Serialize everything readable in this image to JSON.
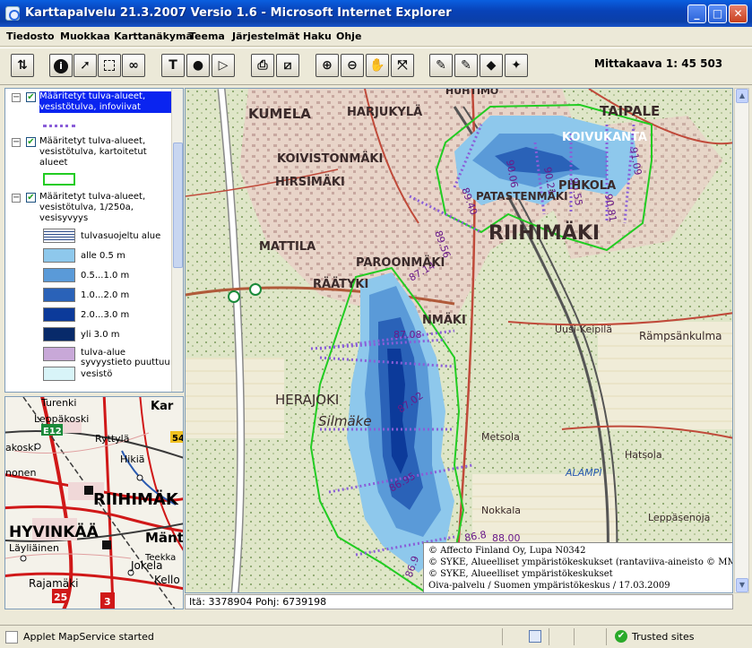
{
  "window": {
    "title": "Karttapalvelu 21.3.2007 Versio 1.6 - Microsoft Internet Explorer",
    "minimize": "_",
    "maximize": "□",
    "close": "✕"
  },
  "menu": [
    "Tiedosto",
    "Muokkaa",
    "Karttanäkymä",
    "Teema",
    "Järjestelmät",
    "Haku",
    "Ohje"
  ],
  "toolbar": {
    "buttons": [
      {
        "name": "refresh-icon"
      },
      {
        "name": "info-icon",
        "glyph": "i"
      },
      {
        "name": "pointer-icon"
      },
      {
        "name": "select-box-icon"
      },
      {
        "name": "binoculars-icon"
      },
      {
        "name": "text-tool-icon",
        "glyph": "T"
      },
      {
        "name": "point-tool-icon"
      },
      {
        "name": "polygon-tool-icon"
      },
      {
        "name": "print-icon"
      },
      {
        "name": "export-icon"
      },
      {
        "name": "zoom-in-icon"
      },
      {
        "name": "zoom-out-icon"
      },
      {
        "name": "pan-hand-icon"
      },
      {
        "name": "full-extent-icon"
      },
      {
        "name": "edit-layer-1-icon"
      },
      {
        "name": "edit-layer-2-icon"
      },
      {
        "name": "back-icon"
      },
      {
        "name": "forward-icon"
      }
    ],
    "scale_label": "Mittakaava 1: 45 503"
  },
  "legend": {
    "groups": [
      {
        "title": [
          "Määritetyt tulva-alueet,",
          "vesistötulva, infoviivat"
        ],
        "selected": true
      },
      {
        "title": [
          "Määritetyt tulva-alueet,",
          "vesistötulva, kartoitetut",
          "alueet"
        ],
        "selected": false
      },
      {
        "title": [
          "Määritetyt tulva-alueet,",
          "vesistötulva, 1/250a,",
          "vesisyvyys"
        ],
        "selected": false
      }
    ],
    "classes": [
      {
        "label": [
          "tulvasuojeltu alue"
        ],
        "color": "#ffffff"
      },
      {
        "label": [
          "alle 0.5 m"
        ],
        "color": "#8ec8ec"
      },
      {
        "label": [
          "0.5...1.0 m"
        ],
        "color": "#5a9ad8"
      },
      {
        "label": [
          "1.0...2.0 m"
        ],
        "color": "#2a62b8"
      },
      {
        "label": [
          "2.0...3.0 m"
        ],
        "color": "#0c3a9a"
      },
      {
        "label": [
          "yli 3.0 m"
        ],
        "color": "#082a6a"
      },
      {
        "label": [
          "tulva-alue",
          "syvyystieto puuttuu"
        ],
        "color": "#c8a8d8"
      },
      {
        "label": [
          "vesistö"
        ],
        "color": "#d8f4f8"
      }
    ]
  },
  "overview_labels": [
    "Turenki",
    "Leppäkoski",
    "Ryttylä",
    "E12",
    "54",
    "Hikiä",
    "RIIHIMÄK",
    "HYVINKÄÄ",
    "Läyliäinen",
    "Mänt",
    "Jokela",
    "Rajamäki",
    "Kello",
    "25",
    "3",
    "akoski",
    "nonen",
    "Kar",
    "Teekka"
  ],
  "map": {
    "place_labels": [
      {
        "text": "KUMELA",
        "size": 15,
        "bold": true
      },
      {
        "text": "HARJUKYLÄ",
        "size": 13,
        "bold": true
      },
      {
        "text": "TAIPALE",
        "size": 15,
        "bold": true
      },
      {
        "text": "KOIVUKANTA",
        "size": 13,
        "bold": true
      },
      {
        "text": "KOIVISTONMÄKI",
        "size": 13,
        "bold": true
      },
      {
        "text": "HIRSIMÄKI",
        "size": 13,
        "bold": true
      },
      {
        "text": "PATASTENMÄKI",
        "size": 12,
        "bold": true
      },
      {
        "text": "PIHKOLA",
        "size": 13,
        "bold": true
      },
      {
        "text": "RIIHIMÄKI",
        "size": 22,
        "bold": true
      },
      {
        "text": "MATTILA",
        "size": 13,
        "bold": true
      },
      {
        "text": "PAROONMÄKI",
        "size": 13,
        "bold": true
      },
      {
        "text": "RÄÄTYKI",
        "size": 13,
        "bold": true
      },
      {
        "text": "NMÄKI",
        "size": 13,
        "bold": true
      },
      {
        "text": "Uusi-Keipilä",
        "size": 11,
        "bold": false
      },
      {
        "text": "Rämpsänkulma",
        "size": 12,
        "bold": false
      },
      {
        "text": "HERAJOKI",
        "size": 15,
        "bold": false
      },
      {
        "text": "Silmäke",
        "size": 15,
        "bold": false
      },
      {
        "text": "Metsola",
        "size": 11,
        "bold": false
      },
      {
        "text": "Hatsola",
        "size": 11,
        "bold": false
      },
      {
        "text": "Nokkala",
        "size": 11,
        "bold": false
      },
      {
        "text": "ALAMPI",
        "size": 11,
        "bold": false
      },
      {
        "text": "Leppäsenoja",
        "size": 11,
        "bold": false
      },
      {
        "text": "HUHTIMO",
        "size": 11,
        "bold": true
      }
    ],
    "flood_levels": [
      "87.14",
      "87.08",
      "87.02",
      "86.95",
      "88.00",
      "89.56",
      "89.40",
      "90.06",
      "90.21",
      "90.55",
      "90.81",
      "91.09",
      "86.9",
      "86.8"
    ],
    "copyright": [
      "© Affecto Finland Oy, Lupa N0342",
      "© SYKE, Alueelliset ympäristökeskukset (rantaviiva-aineisto © MML)",
      "© SYKE, Alueelliset ympäristökeskukset",
      "Oiva-palvelu / Suomen ympäristökeskus / 17.03.2009"
    ]
  },
  "coordinates": "Itä: 3378904 Pohj: 6739198",
  "status": {
    "message": "Applet MapService started",
    "zone": "Trusted sites"
  }
}
